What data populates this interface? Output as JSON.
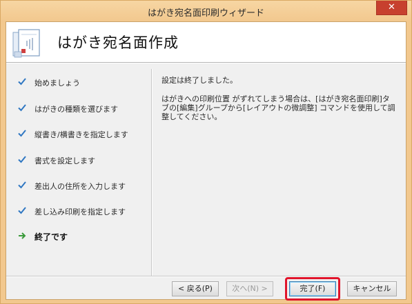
{
  "window": {
    "title": "はがき宛名面印刷ウィザード",
    "close_label": "✕"
  },
  "header": {
    "title": "はがき宛名面作成",
    "icon": "wizard-page-icon"
  },
  "steps": [
    {
      "label": "始めましょう",
      "status": "done",
      "icon": "checkmark-icon"
    },
    {
      "label": "はがきの種類を選びます",
      "status": "done",
      "icon": "checkmark-icon"
    },
    {
      "label": "縦書き/横書きを指定します",
      "status": "done",
      "icon": "checkmark-icon"
    },
    {
      "label": "書式を設定します",
      "status": "done",
      "icon": "checkmark-icon"
    },
    {
      "label": "差出人の住所を入力します",
      "status": "done",
      "icon": "checkmark-icon"
    },
    {
      "label": "差し込み印刷を指定します",
      "status": "done",
      "icon": "checkmark-icon"
    },
    {
      "label": "終了です",
      "status": "current",
      "icon": "arrow-right-icon"
    }
  ],
  "content": {
    "paragraph1": "設定は終了しました。",
    "paragraph2": "はがきへの印刷位置 がずれてしまう場合は、[はがき宛名面印刷]タブの[編集]グループから[レイアウトの微調整] コマンドを使用して調整してください。"
  },
  "buttons": {
    "back": "< 戻る(P)",
    "next": "次へ(N) >",
    "finish": "完了(F)",
    "cancel": "キャンセル"
  },
  "colors": {
    "titlebar": "#f2c88e",
    "close_button": "#c7402e",
    "check": "#2f77c2",
    "arrow": "#3a9a3a",
    "highlight": "#e0142b"
  }
}
